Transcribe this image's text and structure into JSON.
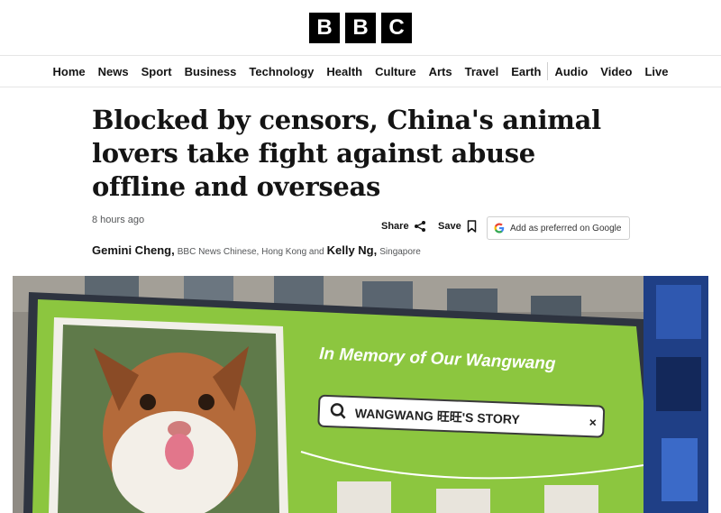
{
  "masthead": {
    "logo_letters": [
      "B",
      "B",
      "C"
    ]
  },
  "nav": {
    "primary": [
      "Home",
      "News",
      "Sport",
      "Business",
      "Technology",
      "Health",
      "Culture",
      "Arts",
      "Travel",
      "Earth"
    ],
    "secondary": [
      "Audio",
      "Video",
      "Live"
    ]
  },
  "article": {
    "headline": "Blocked by censors, China's animal lovers take fight against abuse offline and overseas",
    "timestamp": "8 hours ago",
    "share_label": "Share",
    "save_label": "Save",
    "google_label": "Add as preferred on Google",
    "byline": {
      "author1": "Gemini Cheng,",
      "affiliation1": "BBC News Chinese, Hong Kong and",
      "author2": "Kelly Ng,",
      "affiliation2": "Singapore"
    }
  },
  "hero": {
    "billboard_title": "In Memory of Our Wangwang",
    "search_text": "WANGWANG 旺旺'S STORY",
    "search_close": "×",
    "colors": {
      "billboard_green": "#8cc63f",
      "sky_building": "#9b9890"
    }
  }
}
